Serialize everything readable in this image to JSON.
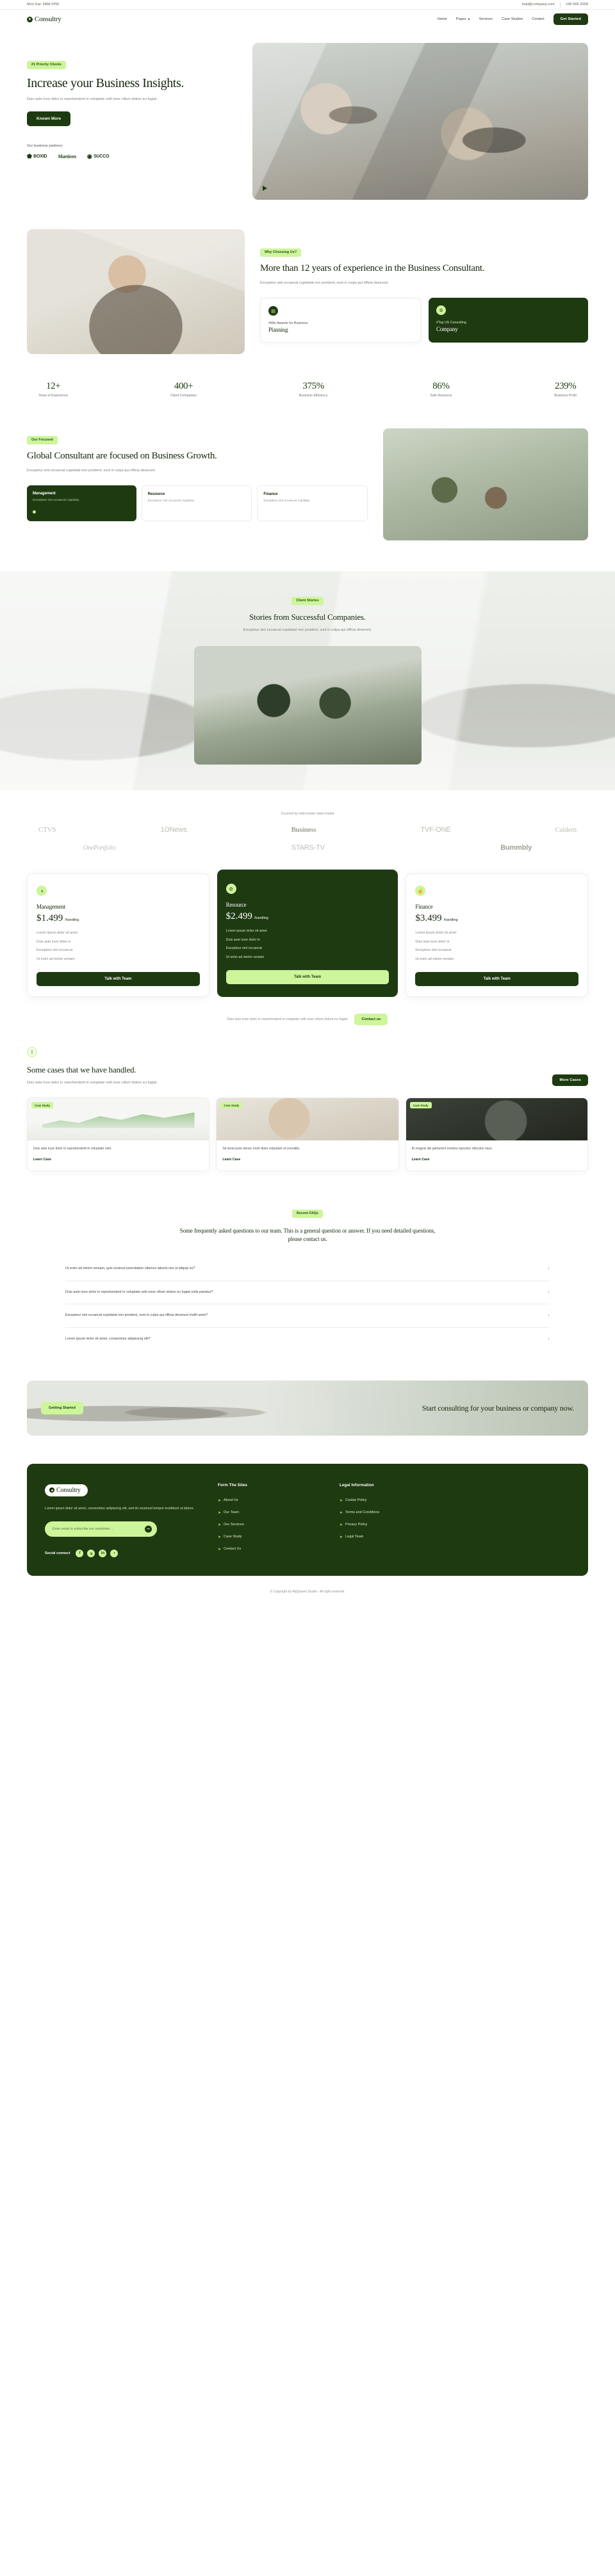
{
  "topbar": {
    "hours": "Mon-Sat: 9AM-5PM",
    "email": "mail@company.com",
    "phone": "+58 569-2558"
  },
  "nav": {
    "logo": "Consultry",
    "links": [
      {
        "label": "Home",
        "caret": false
      },
      {
        "label": "Pages",
        "caret": true
      },
      {
        "label": "Services",
        "caret": false
      },
      {
        "label": "Case Studies",
        "caret": false
      },
      {
        "label": "Contact",
        "caret": false
      }
    ],
    "cta": "Get Started"
  },
  "hero": {
    "badge": "#1 Priority Clients",
    "title": "Increase your Business Insights.",
    "desc": "Duis aute irure dolor in reprehenderit in voluptate velit esse cillum dolore eu fugiat.",
    "cta": "Known More",
    "partners_label": "Our business partners:",
    "partners": [
      {
        "glyph": "⬟",
        "name": "BOXID"
      },
      {
        "glyph": "",
        "name": "Martieen"
      },
      {
        "glyph": "◉",
        "name": "SUCCO"
      }
    ]
  },
  "why": {
    "badge": "Why Choosing Us?",
    "title": "More than 12 years of experience in the Business Consultant.",
    "desc": "Excepteur sint occaecat cupidatat non proident, sunt in culpa qui officia deserunt.",
    "cards": [
      {
        "icon": "▤",
        "sub": "#Win Awards for Business",
        "title": "Planning"
      },
      {
        "icon": "⚙",
        "sub": "#Top US Consulting",
        "title": "Company"
      }
    ]
  },
  "stats": [
    {
      "num": "12+",
      "label": "Years of Experience"
    },
    {
      "num": "400+",
      "label": "Client Companies"
    },
    {
      "num": "375%",
      "label": "Business Efficiency"
    },
    {
      "num": "86%",
      "label": "Safe Resource"
    },
    {
      "num": "239%",
      "label": "Business Profit"
    }
  ],
  "focused": {
    "badge": "Our Focused",
    "title": "Global Consultant are focused on Business Growth.",
    "desc": "Excepteur sint occaecat cupidatat non proident, sunt in culpa qui officia deserunt.",
    "cards": [
      {
        "title": "Management",
        "text": "Excepteur sint occaecat cupidata."
      },
      {
        "title": "Resource",
        "text": "Excepteur sint occaecat cupidata."
      },
      {
        "title": "Finance",
        "text": "Excepteur sint occaecat cupidata."
      }
    ]
  },
  "stories": {
    "badge": "Client Stories",
    "title": "Stories from Successful Companies.",
    "desc": "Excepteur sint occaecat cupidatat non proident, sunt in culpa qui officia deserunt."
  },
  "brands": {
    "caption": "Covered by well-known news media",
    "row1": [
      "CTVS",
      "1ONews",
      "Business",
      "TVF-ONE",
      "Caldern"
    ],
    "row2": [
      "OnePortfolio",
      "STARS-TV",
      "Bummbly"
    ]
  },
  "pricing": [
    {
      "icon": "◑",
      "name": "Management",
      "price": "$1.499",
      "period": "/handling",
      "features": [
        "Lorem ipsum dolor sit amet",
        "Duis aute irure dolor in",
        "Excepteur sint occaecat",
        "Ut enim ad minim veniam"
      ],
      "button": "Talk with Team",
      "highlighted": false
    },
    {
      "icon": "⚙",
      "name": "Resource",
      "price": "$2.499",
      "period": "/handling",
      "features": [
        "Lorem ipsum dolor sit amet",
        "Duis aute irure dolor in",
        "Excepteur sint occaecat",
        "Ut enim ad minim veniam"
      ],
      "button": "Talk with Team",
      "highlighted": true
    },
    {
      "icon": "☝",
      "name": "Finance",
      "price": "$3.499",
      "period": "/handling",
      "features": [
        "Lorem ipsum dolor sit amet",
        "Duis aute irure dolor in",
        "Excepteur sint occaecat",
        "Ut enim ad minim veniam"
      ],
      "button": "Talk with Team",
      "highlighted": false
    }
  ],
  "cta_small": {
    "text": "Duis aute irure dolor in reprehenderit in voluptate velit esse cillum dolore eu fugiat.",
    "button": "Contact us"
  },
  "cases": {
    "icon": "!",
    "title": "Some cases that we have handled.",
    "desc": "Duis aute irure dolor in reprehenderit in voluptate velit esse cillum dolore eu fugiat.",
    "button": "More Cases",
    "items": [
      {
        "tag": "Case Study",
        "text": "Duis aute irure dolor in reprehenderit in voluptate velit.",
        "link": "Learn Case"
      },
      {
        "tag": "Case Study",
        "text": "Sit amet justo donec enim diam volputaet ut convallis.",
        "link": "Learn Case"
      },
      {
        "tag": "Case Study",
        "text": "Et magnis dis parturient montes nascetur ridiculus risus.",
        "link": "Learn Case"
      }
    ]
  },
  "faq": {
    "badge": "Recent FAQs",
    "heading": "Some frequently asked questions to our team. This is a general question or answer. If you need detailed questions, please contact us.",
    "items": [
      "Ut enim ad minim veniam, quis nostrud exercitation ullamco laboris nisi ut aliquip ex?",
      "Duis aute irure dolor in reprehenderit in voluptate velit esse cillum dolore eu fugiat nulla pariatur?",
      "Excepteur sint occaecat cupidatat non proident, sunt in culpa qui officia deserunt mollit anim?",
      "Lorem ipsum dolor sit amet, consectetur adipiscing elit?"
    ]
  },
  "banner": {
    "button": "Getting Started",
    "title": "Start consulting for your business or company now."
  },
  "footer": {
    "logo": "Consultry",
    "desc": "Lorem ipsum dolor sit amet, consectetur adipiscing elit, sed do eiusmod tempor incididunt ut labore.",
    "newsletter_placeholder": "Enter email to subscribe our newsletter ...",
    "social_label": "Social connect",
    "socials": [
      "f",
      "𝕩",
      "in",
      "▪"
    ],
    "columns": [
      {
        "title": "Form The Sites",
        "links": [
          "About Us",
          "Our Team",
          "Our Services",
          "Case Study",
          "Contact Us"
        ]
      },
      {
        "title": "Legal Information",
        "links": [
          "Cookie Policy",
          "Terms and Conditions",
          "Privacy Policy",
          "Legal Team"
        ]
      }
    ],
    "copyright": "© Copyright by AbQasem Studio - All right reserved."
  }
}
